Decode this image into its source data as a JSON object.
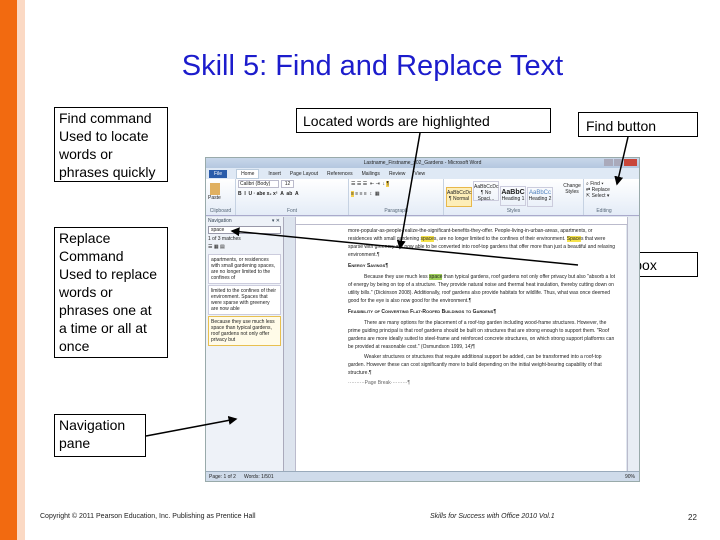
{
  "slide": {
    "title": "Skill 5: Find and Replace Text",
    "page_number": "22",
    "copyright": "Copyright © 2011 Pearson Education, Inc. Publishing as Prentice Hall",
    "series": "Skills for Success with Office 2010 Vol.1",
    "accent": "#f26a10",
    "title_color": "#1c1ccc"
  },
  "callouts": {
    "find_title": "Find command",
    "find_body": "Used to locate words or phrases quickly",
    "replace_title": "Replace Command",
    "replace_body": "Used to replace words or phrases one at a time or all at once",
    "nav": "Navigation pane",
    "located": "Located words are highlighted",
    "find_button": "Find button",
    "search_box": "Search box"
  },
  "word": {
    "title": "Lastname_Firstname_s02_Gardens - Microsoft Word",
    "tabs": [
      "File",
      "Home",
      "Insert",
      "Page Layout",
      "References",
      "Mailings",
      "Review",
      "View"
    ],
    "font": "Calibri (Body)",
    "size": "12",
    "groups": [
      "Clipboard",
      "Font",
      "Paragraph",
      "Styles",
      "Editing"
    ],
    "paste": "Paste",
    "styles": [
      {
        "preview": "AaBbCcDc",
        "name": "¶ Normal"
      },
      {
        "preview": "AaBbCcDc",
        "name": "¶ No Spaci..."
      },
      {
        "preview": "AaBbC",
        "name": "Heading 1"
      },
      {
        "preview": "AaBbCc",
        "name": "Heading 2"
      }
    ],
    "change_styles": "Change Styles",
    "editing": [
      "Find",
      "Replace",
      "Select"
    ],
    "nav": {
      "header": "Navigation",
      "search": "space",
      "matches": "1 of 3 matches",
      "results": [
        "apartments, or residences with small gardening spaces, are no longer limited to the confines of",
        "limited to the confines of their environment. Spaces that were sparse with greenery are now able",
        "Because they use much less space than typical gardens, roof gardens not only offer privacy but"
      ]
    },
    "doc": {
      "p1a": "more-popular-as-people-realize-the-significant-benefits-they-offer. People-living-in-urban-areas, apartments, or residences with small gardening ",
      "m1": "space",
      "p1b": "s, are no longer limited to the confines of their environment. ",
      "m2": "Space",
      "p1c": "s that were sparse with greenery are now able to be converted into roof-top gardens that offer more than just a beautiful and relaxing environment.¶",
      "h1": "Energy Savings¶",
      "p2a": "Because they use much less ",
      "m3": "space",
      "p2b": " than typical gardens, roof gardens not only offer privacy but also \"absorb a lot of energy by being on top of a structure. They provide natural noise and thermal heat insulation, thereby cutting down on utility bills.\" (Dickinson 2008). Additionally, roof gardens also provide habitats for wildlife. Thus, what was once deemed good for the eye is also now good for the environment.¶",
      "h2": "Feasibility of Converting Flat-Roofed Buildings to Gardens¶",
      "p3": "There are many options for the placement of a roof-top garden including wood-frame structures. However, the prime guiding principal is that roof gardens should be built on structures that are strong enough to support them. \"Roof gardens are more ideally suited to steel-frame and reinforced concrete structures, on which strong support platforms can be provided at reasonable cost.\" (Osmundson 1999, 14)¶",
      "p4": "Weaker structures or structures that require additional support be added, can be transformed into a roof-top garden. However these can cost significantly more to build depending on the initial weight-bearing capability of that structure.¶",
      "pagebreak": "··········Page Break··········¶"
    },
    "status": {
      "page": "Page: 1 of 2",
      "words": "Words: 1/501",
      "zoom": "90%"
    }
  }
}
